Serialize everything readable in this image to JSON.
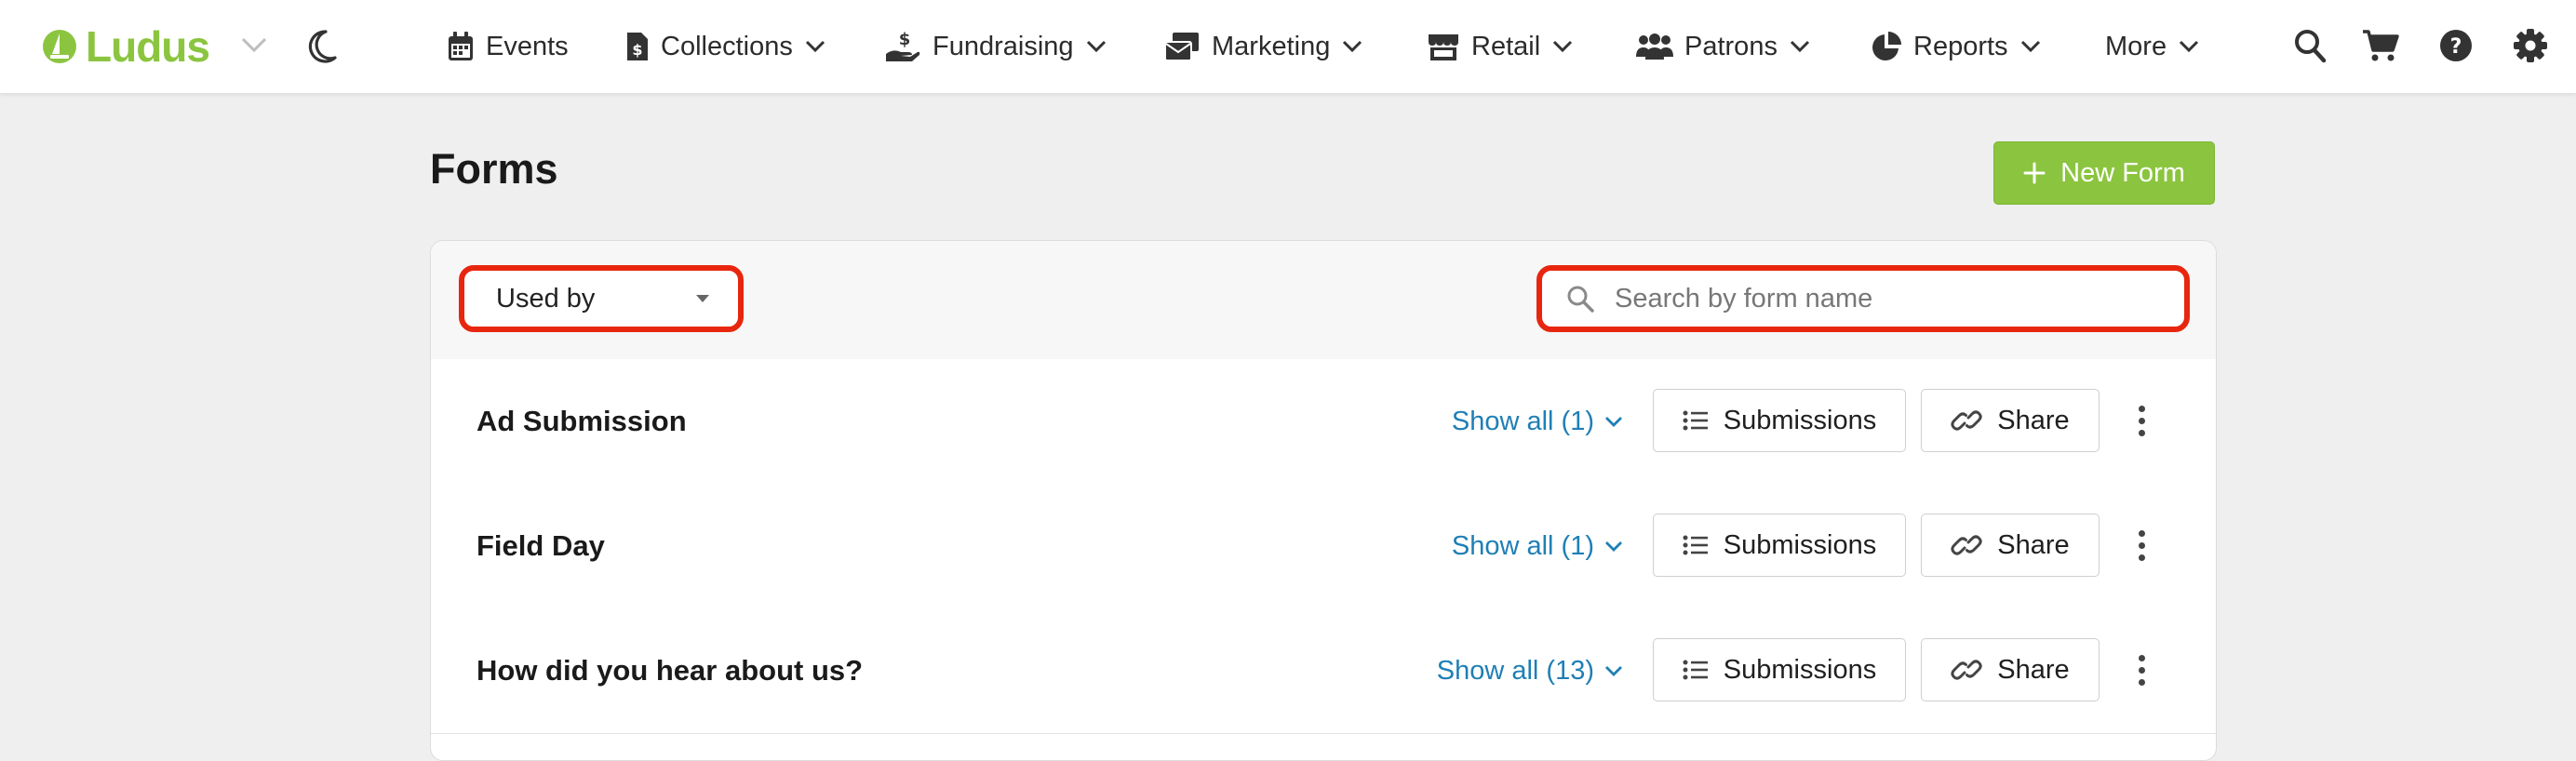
{
  "app": {
    "name": "Ludus",
    "brand_color": "#8bc53f",
    "link_color": "#1f7fb5",
    "highlight_color": "#e8260f"
  },
  "nav": {
    "items": [
      {
        "label": "Events",
        "icon": "calendar-icon"
      },
      {
        "label": "Collections",
        "icon": "file-dollar-icon"
      },
      {
        "label": "Fundraising",
        "icon": "hand-dollar-icon"
      },
      {
        "label": "Marketing",
        "icon": "envelopes-icon"
      },
      {
        "label": "Retail",
        "icon": "store-icon"
      },
      {
        "label": "Patrons",
        "icon": "users-icon"
      },
      {
        "label": "Reports",
        "icon": "pie-chart-icon"
      },
      {
        "label": "More"
      }
    ],
    "right_icons": [
      "search-icon",
      "cart-icon",
      "help-icon",
      "gear-icon"
    ]
  },
  "page": {
    "title": "Forms",
    "new_form_label": "New Form"
  },
  "filters": {
    "used_by_label": "Used by",
    "search_placeholder": "Search by form name"
  },
  "forms": [
    {
      "name": "Ad Submission",
      "show_all": "Show all (1)",
      "submissions_label": "Submissions",
      "share_label": "Share"
    },
    {
      "name": "Field Day",
      "show_all": "Show all (1)",
      "submissions_label": "Submissions",
      "share_label": "Share"
    },
    {
      "name": "How did you hear about us?",
      "show_all": "Show all (13)",
      "submissions_label": "Submissions",
      "share_label": "Share"
    }
  ]
}
